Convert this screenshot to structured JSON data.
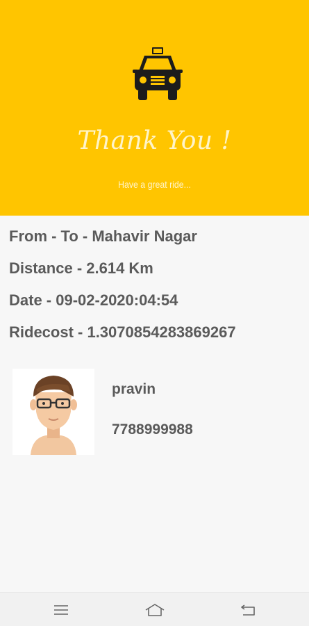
{
  "header": {
    "title": "Thank You !",
    "subtitle": "Have a great ride..."
  },
  "ride": {
    "from_to": "From - To - Mahavir Nagar",
    "distance": "Distance - 2.614 Km",
    "date": "Date - 09-02-2020:04:54",
    "ridecost": "Ridecost - 1.3070854283869267"
  },
  "driver": {
    "name": "pravin",
    "phone": "7788999988"
  },
  "icons": {
    "taxi": "taxi-icon",
    "avatar": "driver-avatar",
    "menu": "menu-icon",
    "home": "home-icon",
    "back": "back-icon"
  },
  "colors": {
    "accent": "#ffc500",
    "text": "#5a5a5a",
    "background": "#f7f7f7"
  }
}
